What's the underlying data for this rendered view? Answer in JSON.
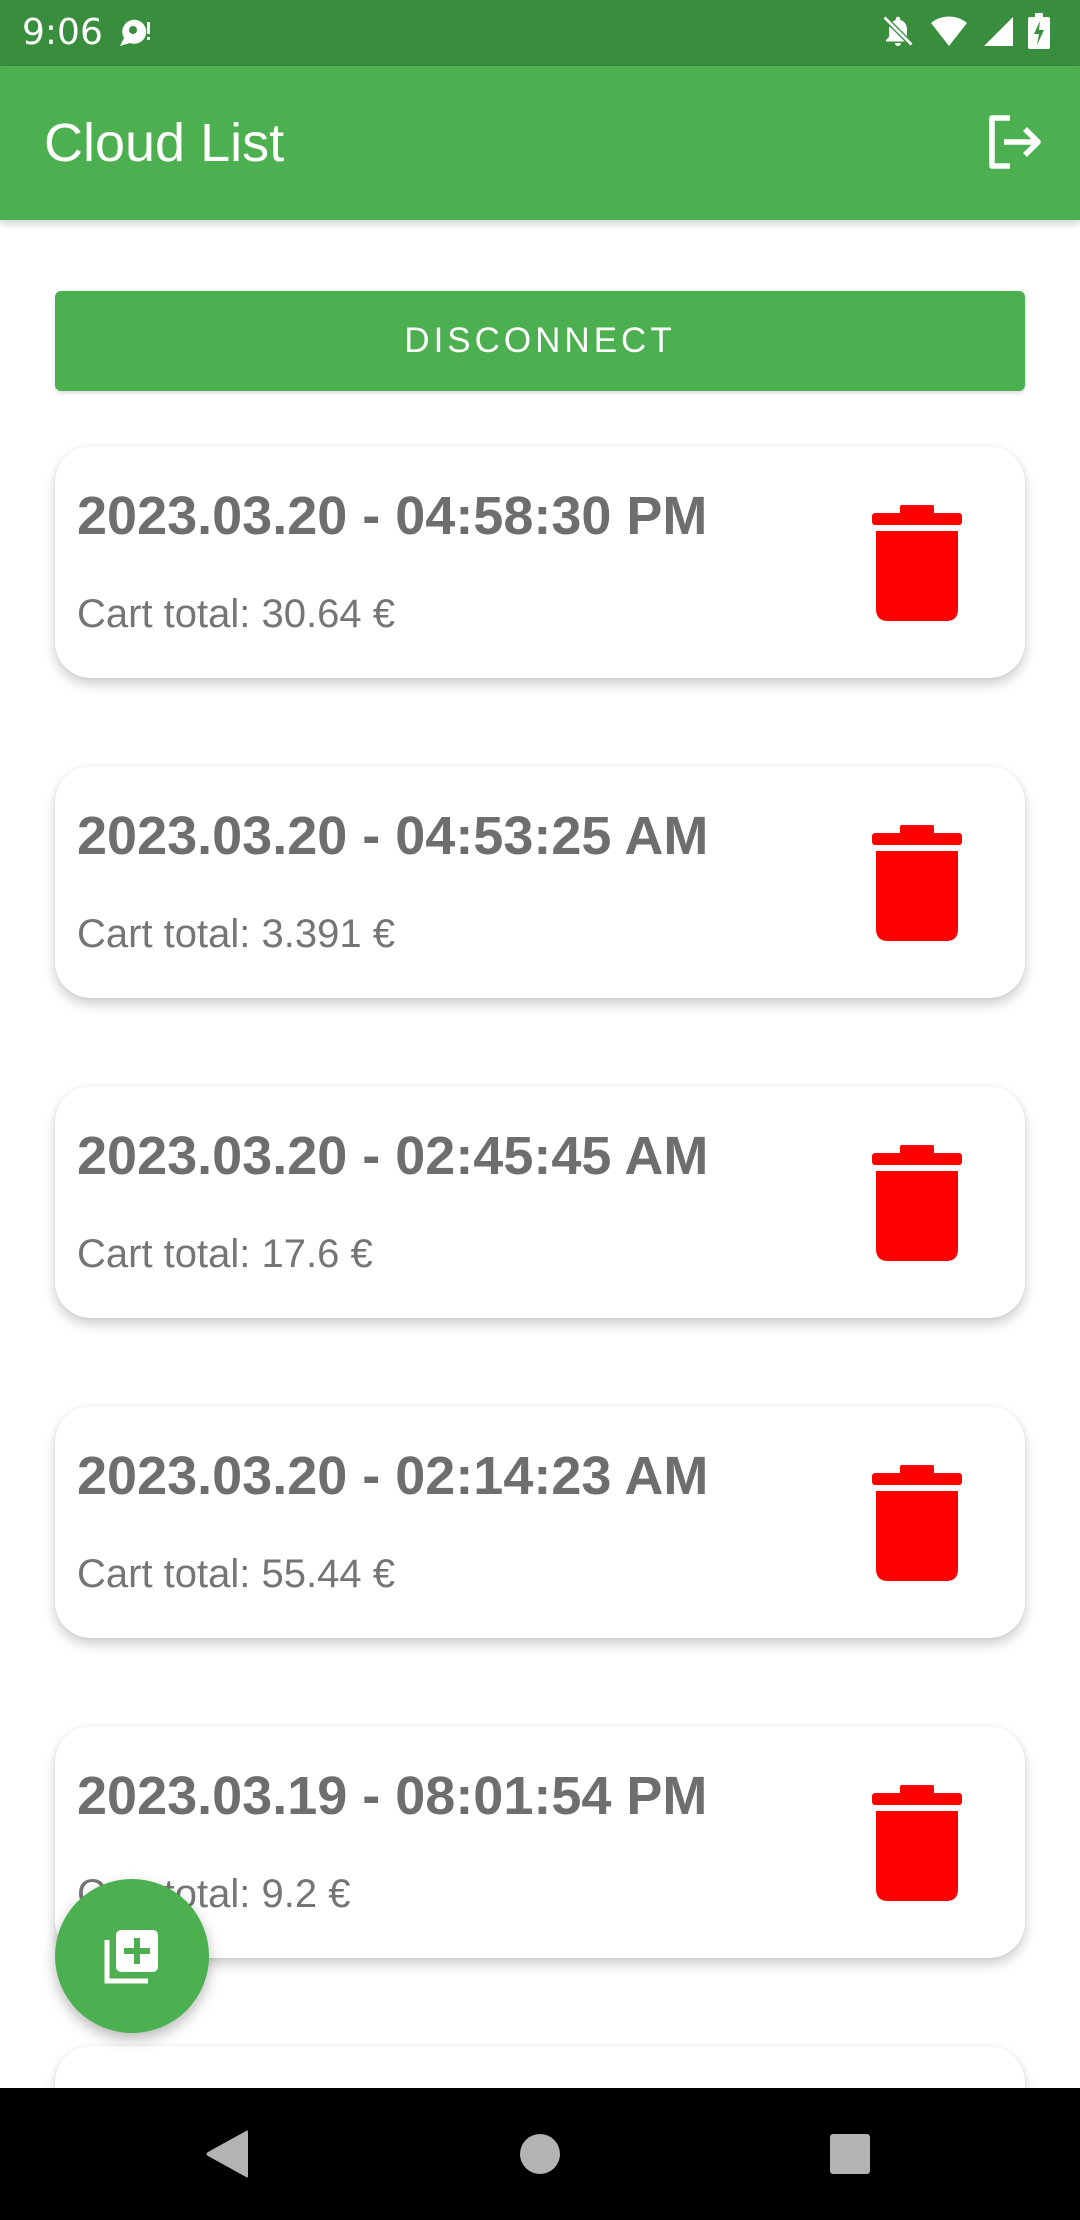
{
  "status_bar": {
    "time": "9:06",
    "icons": [
      "notification-bubble-icon",
      "notifications-off-icon",
      "wifi-icon",
      "cell-signal-icon",
      "battery-charging-icon"
    ]
  },
  "app_bar": {
    "title": "Cloud List",
    "action_icon": "logout-icon"
  },
  "disconnect_button": {
    "label": "DISCONNECT"
  },
  "carts": [
    {
      "date": "2023.03.20 - 04:58:30 PM",
      "total": "Cart total: 30.64 €"
    },
    {
      "date": "2023.03.20 - 04:53:25 AM",
      "total": "Cart total: 3.391 €"
    },
    {
      "date": "2023.03.20 - 02:45:45 AM",
      "total": "Cart total: 17.6 €"
    },
    {
      "date": "2023.03.20 - 02:14:23 AM",
      "total": "Cart total: 55.44 €"
    },
    {
      "date": "2023.03.19 - 08:01:54 PM",
      "total": "Cart total: 9.2 €"
    },
    {
      "date": "",
      "total": ""
    }
  ],
  "fab": {
    "icon": "library-add-icon"
  },
  "nav_bar": {
    "icons": [
      "back-icon",
      "home-icon",
      "recents-icon"
    ]
  },
  "colors": {
    "status_bar": "#388e3c",
    "primary": "#4caf50",
    "delete": "#ff0000",
    "card_title": "#6e6e6e",
    "card_text": "#757575"
  }
}
